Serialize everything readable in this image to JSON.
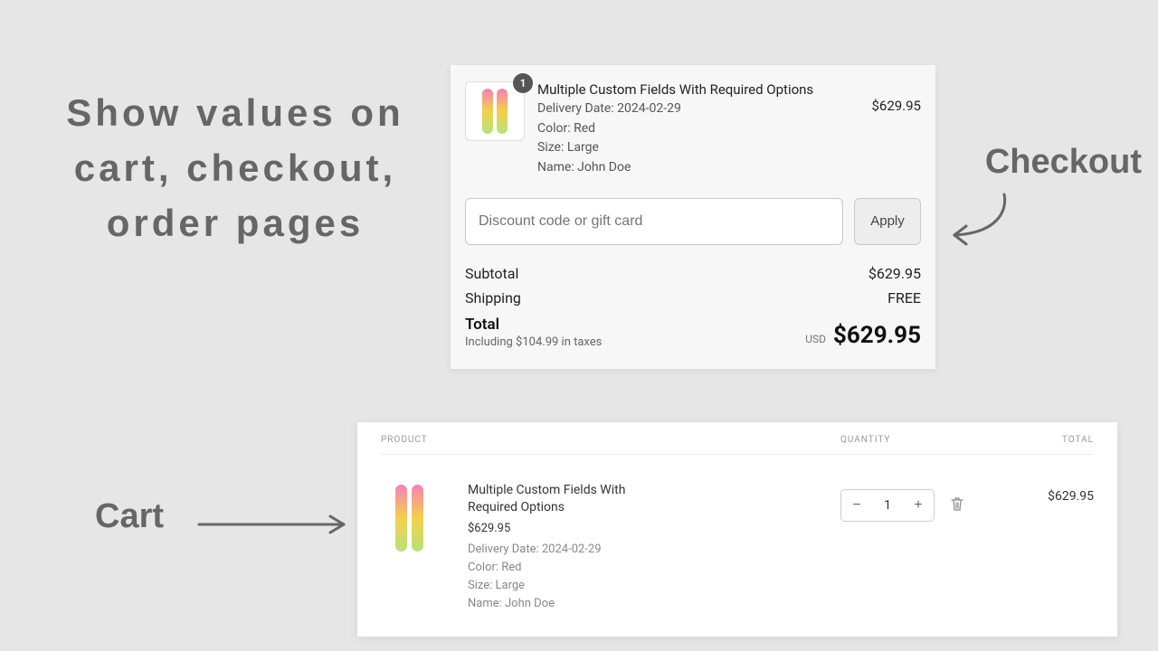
{
  "heading": "Show values on cart, checkout, order pages",
  "labels": {
    "checkout": "Checkout",
    "cart": "Cart"
  },
  "checkout": {
    "badge": "1",
    "product_title": "Multiple Custom Fields With Required Options",
    "lines": {
      "delivery": "Delivery Date: 2024-02-29",
      "color": "Color: Red",
      "size": "Size: Large",
      "name": "Name: John Doe"
    },
    "line_price": "$629.95",
    "discount_placeholder": "Discount code or gift card",
    "apply_label": "Apply",
    "subtotal_label": "Subtotal",
    "subtotal_value": "$629.95",
    "shipping_label": "Shipping",
    "shipping_value": "FREE",
    "total_label": "Total",
    "tax_note": "Including $104.99 in taxes",
    "currency": "USD",
    "total_value": "$629.95"
  },
  "cart": {
    "headers": {
      "product": "PRODUCT",
      "quantity": "QUANTITY",
      "total": "TOTAL"
    },
    "item": {
      "title": "Multiple Custom Fields With Required Options",
      "price": "$629.95",
      "delivery": "Delivery Date: 2024-02-29",
      "color": "Color: Red",
      "size": "Size: Large",
      "name": "Name: John Doe",
      "qty": "1",
      "line_total": "$629.95"
    }
  }
}
